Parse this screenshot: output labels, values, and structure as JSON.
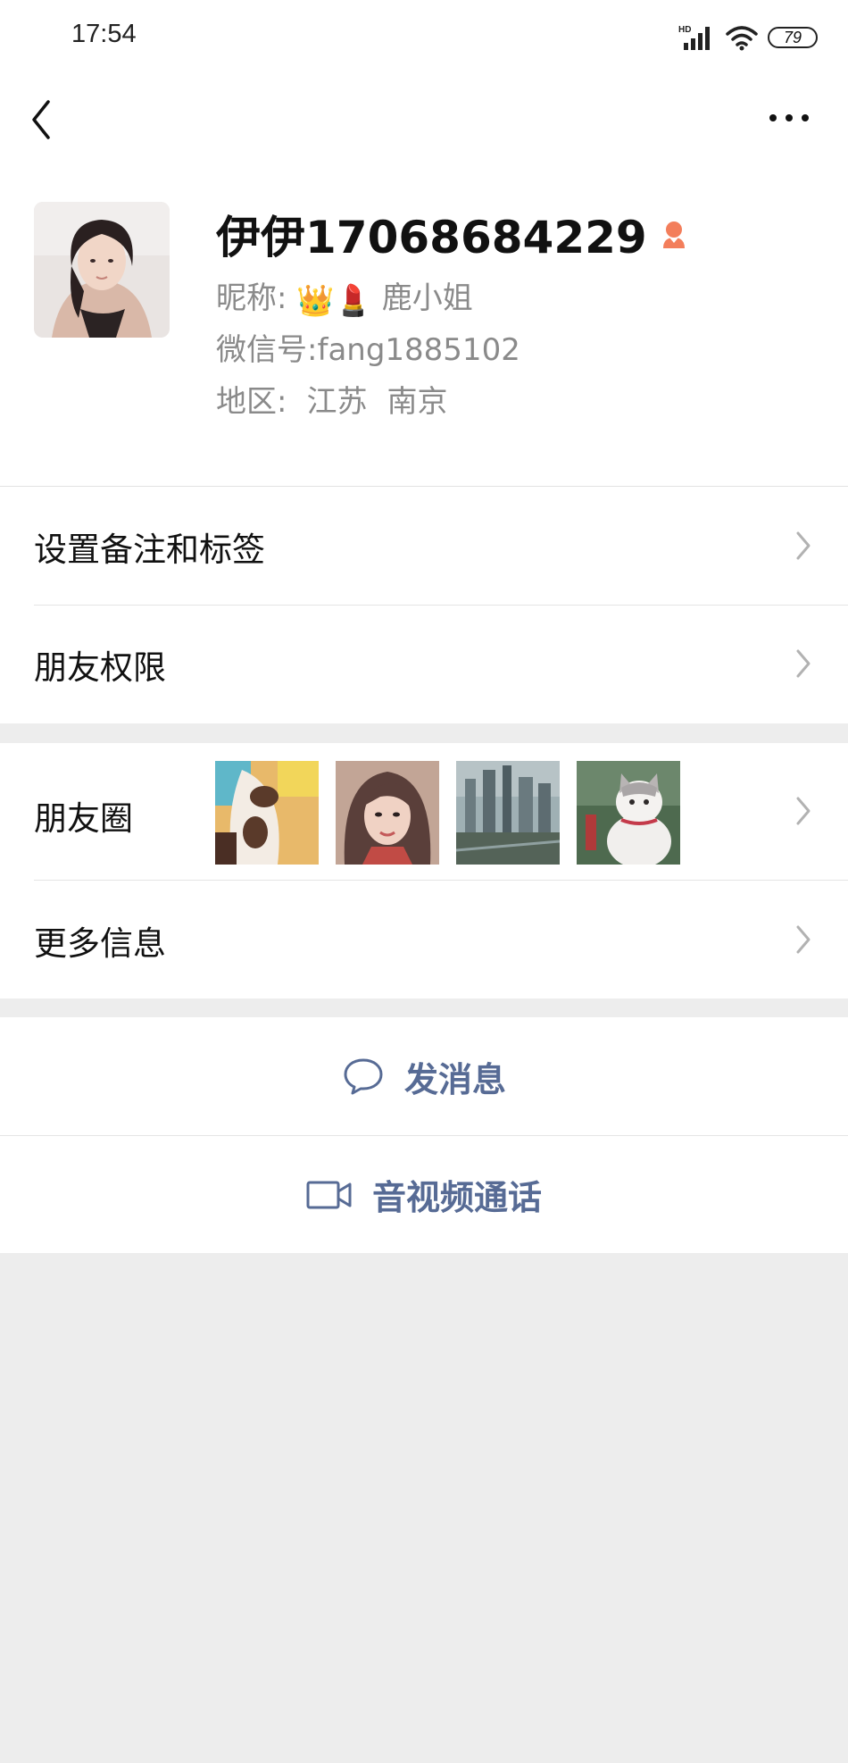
{
  "status_bar": {
    "time": "17:54",
    "network_label": "HD",
    "battery": "79"
  },
  "profile": {
    "name": "伊伊17068684229",
    "nickname_label": "昵称:",
    "nickname_emojis": "👑💄",
    "nickname": "鹿小姐",
    "wechat_id_label": "微信号:",
    "wechat_id": "fang1885102",
    "region_label": "地区:",
    "region_province": "江苏",
    "region_city": "南京"
  },
  "menu": {
    "remark_tags": "设置备注和标签",
    "friend_permissions": "朋友权限",
    "moments": "朋友圈",
    "more_info": "更多信息"
  },
  "actions": {
    "send_message": "发消息",
    "video_call": "音视频通话"
  },
  "colors": {
    "link_blue": "#576b95",
    "gender_female": "#f37e5b",
    "page_bg": "#ededed"
  }
}
